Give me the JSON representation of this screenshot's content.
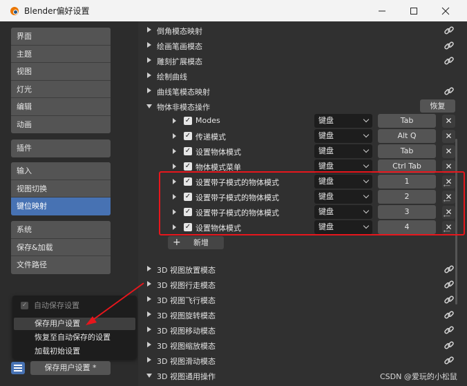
{
  "window": {
    "title": "Blender偏好设置",
    "minimize_icon": "minimize-icon",
    "maximize_icon": "maximize-icon",
    "close_icon": "close-icon"
  },
  "sidebar": {
    "group1": [
      "界面",
      "主题",
      "视图",
      "灯光",
      "编辑",
      "动画"
    ],
    "group2": [
      "插件"
    ],
    "group3": [
      "输入",
      "视图切换",
      "键位映射"
    ],
    "group4": [
      "系统",
      "保存&加载",
      "文件路径"
    ],
    "active_item": "键位映射"
  },
  "menu_popup": {
    "autosave_label": "自动保存设置",
    "items": [
      "保存用户设置",
      "恢复至自动保存的设置",
      "加载初始设置"
    ]
  },
  "footer": {
    "save_button_label": "保存用户设置 *"
  },
  "categories_top": [
    {
      "label": "倒角模态映射",
      "linked": true
    },
    {
      "label": "绘画笔画模态",
      "linked": true
    },
    {
      "label": "雕刻扩展模态",
      "linked": true
    },
    {
      "label": "绘制曲线",
      "linked": false
    },
    {
      "label": "曲线笔模态映射",
      "linked": true
    }
  ],
  "expanded_category": {
    "label": "物体非模态操作",
    "restore_label": "恢复"
  },
  "keymap_items": [
    {
      "name": "Modes",
      "device": "键盘",
      "key": "Tab"
    },
    {
      "name": "传递模式",
      "device": "键盘",
      "key": "Alt Q"
    },
    {
      "name": "设置物体模式",
      "device": "键盘",
      "key": "Tab"
    },
    {
      "name": "物体模式菜单",
      "device": "键盘",
      "key": "Ctrl Tab"
    },
    {
      "name": "设置带子模式的物体模式",
      "device": "键盘",
      "key": "1"
    },
    {
      "name": "设置带子模式的物体模式",
      "device": "键盘",
      "key": "2"
    },
    {
      "name": "设置带子模式的物体模式",
      "device": "键盘",
      "key": "3"
    },
    {
      "name": "设置物体模式",
      "device": "键盘",
      "key": "4"
    }
  ],
  "add_new_label": "新增",
  "categories_bottom": [
    {
      "label": "3D 视图放置模态",
      "linked": true
    },
    {
      "label": "3D 视图行走模态",
      "linked": true
    },
    {
      "label": "3D 视图飞行模态",
      "linked": true
    },
    {
      "label": "3D 视图旋转模态",
      "linked": true
    },
    {
      "label": "3D 视图移动模态",
      "linked": true
    },
    {
      "label": "3D 视图缩放模态",
      "linked": true
    },
    {
      "label": "3D 视图滑动模态",
      "linked": true
    },
    {
      "label": "3D 视图通用操作",
      "linked": false
    }
  ],
  "watermark": "CSDN @爱玩的小松鼠",
  "colors": {
    "accent": "#4772b3",
    "highlight_box": "#e8161c",
    "arrow": "#e8161c"
  }
}
